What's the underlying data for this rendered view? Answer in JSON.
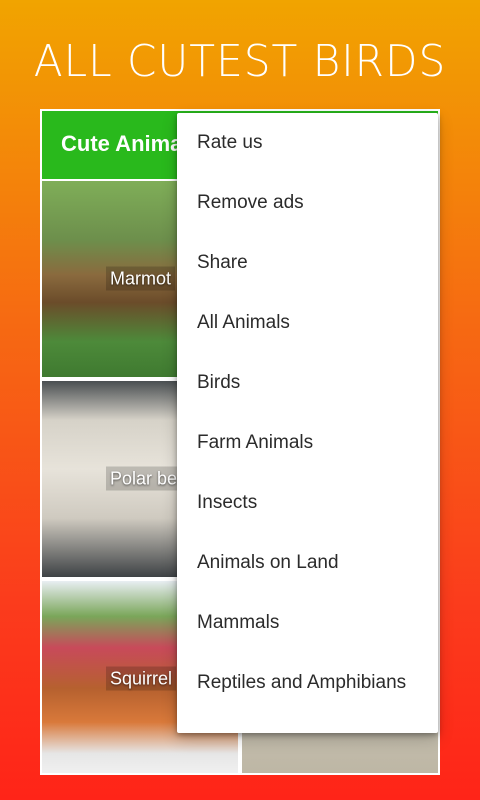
{
  "promo": {
    "title": "ALL CUTEST BIRDS"
  },
  "app": {
    "toolbar_title": "Cute Animals"
  },
  "tiles": [
    {
      "label": "Marmot"
    },
    {
      "label": "Polar bear"
    },
    {
      "label": "Squirrel"
    }
  ],
  "menu": {
    "items": [
      "Rate us",
      "Remove ads",
      "Share",
      "All Animals",
      "Birds",
      "Farm Animals",
      "Insects",
      "Animals on Land",
      "Mammals",
      "Reptiles and Amphibians"
    ]
  },
  "colors": {
    "toolbar": "#29b91c",
    "gradient_top": "#f1a400",
    "gradient_bottom": "#ff2418"
  }
}
